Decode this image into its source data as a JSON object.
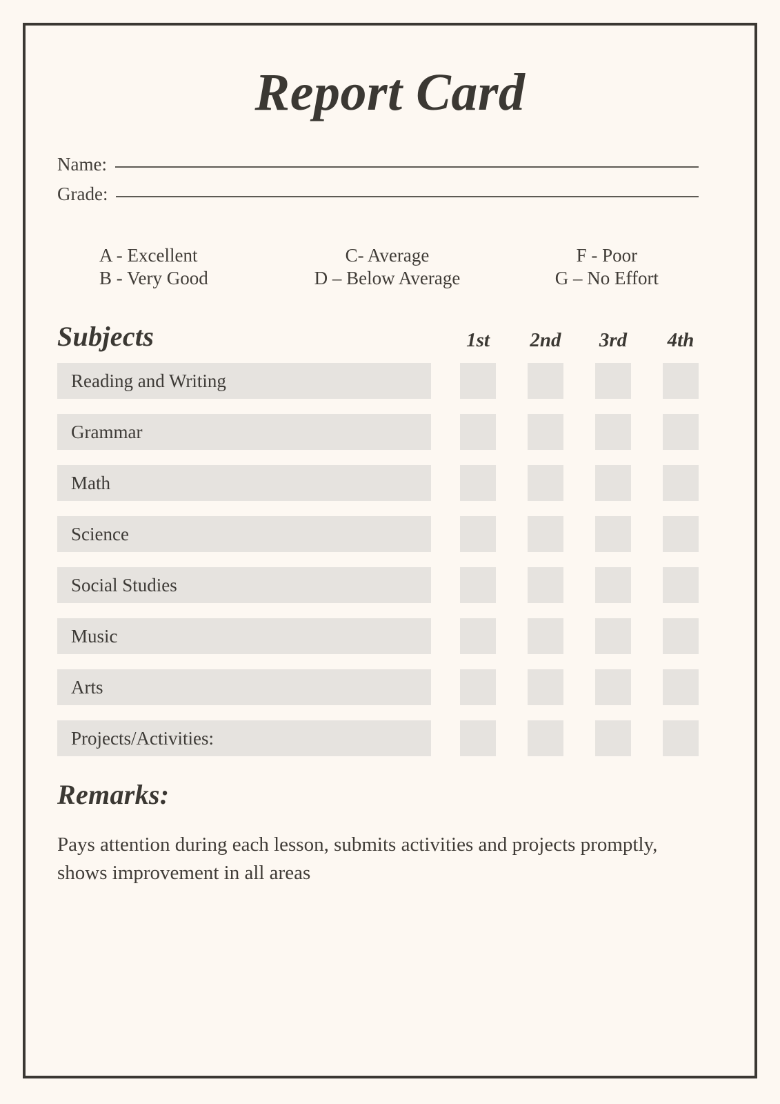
{
  "document": {
    "title": "Report Card",
    "background_color": "#fdf8f2",
    "border_color": "#3b3833",
    "bar_color": "#e6e3df",
    "text_color": "#3d3a36"
  },
  "fields": [
    {
      "label": "Name:",
      "value": ""
    },
    {
      "label": "Grade:",
      "value": ""
    }
  ],
  "legend": {
    "columns": [
      {
        "lines": [
          "A - Excellent",
          "B - Very Good"
        ]
      },
      {
        "lines": [
          "C- Average",
          "D – Below Average"
        ]
      },
      {
        "lines": [
          "F - Poor",
          "G – No Effort"
        ]
      }
    ]
  },
  "table": {
    "subjects_header": "Subjects",
    "quarters": [
      "1st",
      "2nd",
      "3rd",
      "4th"
    ],
    "rows": [
      {
        "subject": "Reading and Writing",
        "marks": [
          "",
          "",
          "",
          ""
        ]
      },
      {
        "subject": "Grammar",
        "marks": [
          "",
          "",
          "",
          ""
        ]
      },
      {
        "subject": "Math",
        "marks": [
          "",
          "",
          "",
          ""
        ]
      },
      {
        "subject": "Science",
        "marks": [
          "",
          "",
          "",
          ""
        ]
      },
      {
        "subject": "Social Studies",
        "marks": [
          "",
          "",
          "",
          ""
        ]
      },
      {
        "subject": "Music",
        "marks": [
          "",
          "",
          "",
          ""
        ]
      },
      {
        "subject": "Arts",
        "marks": [
          "",
          "",
          "",
          ""
        ]
      },
      {
        "subject": "Projects/Activities:",
        "marks": [
          "",
          "",
          "",
          ""
        ]
      }
    ]
  },
  "remarks": {
    "heading": "Remarks:",
    "text": "Pays attention during each lesson, submits activities and projects promptly, shows improvement in all areas"
  }
}
